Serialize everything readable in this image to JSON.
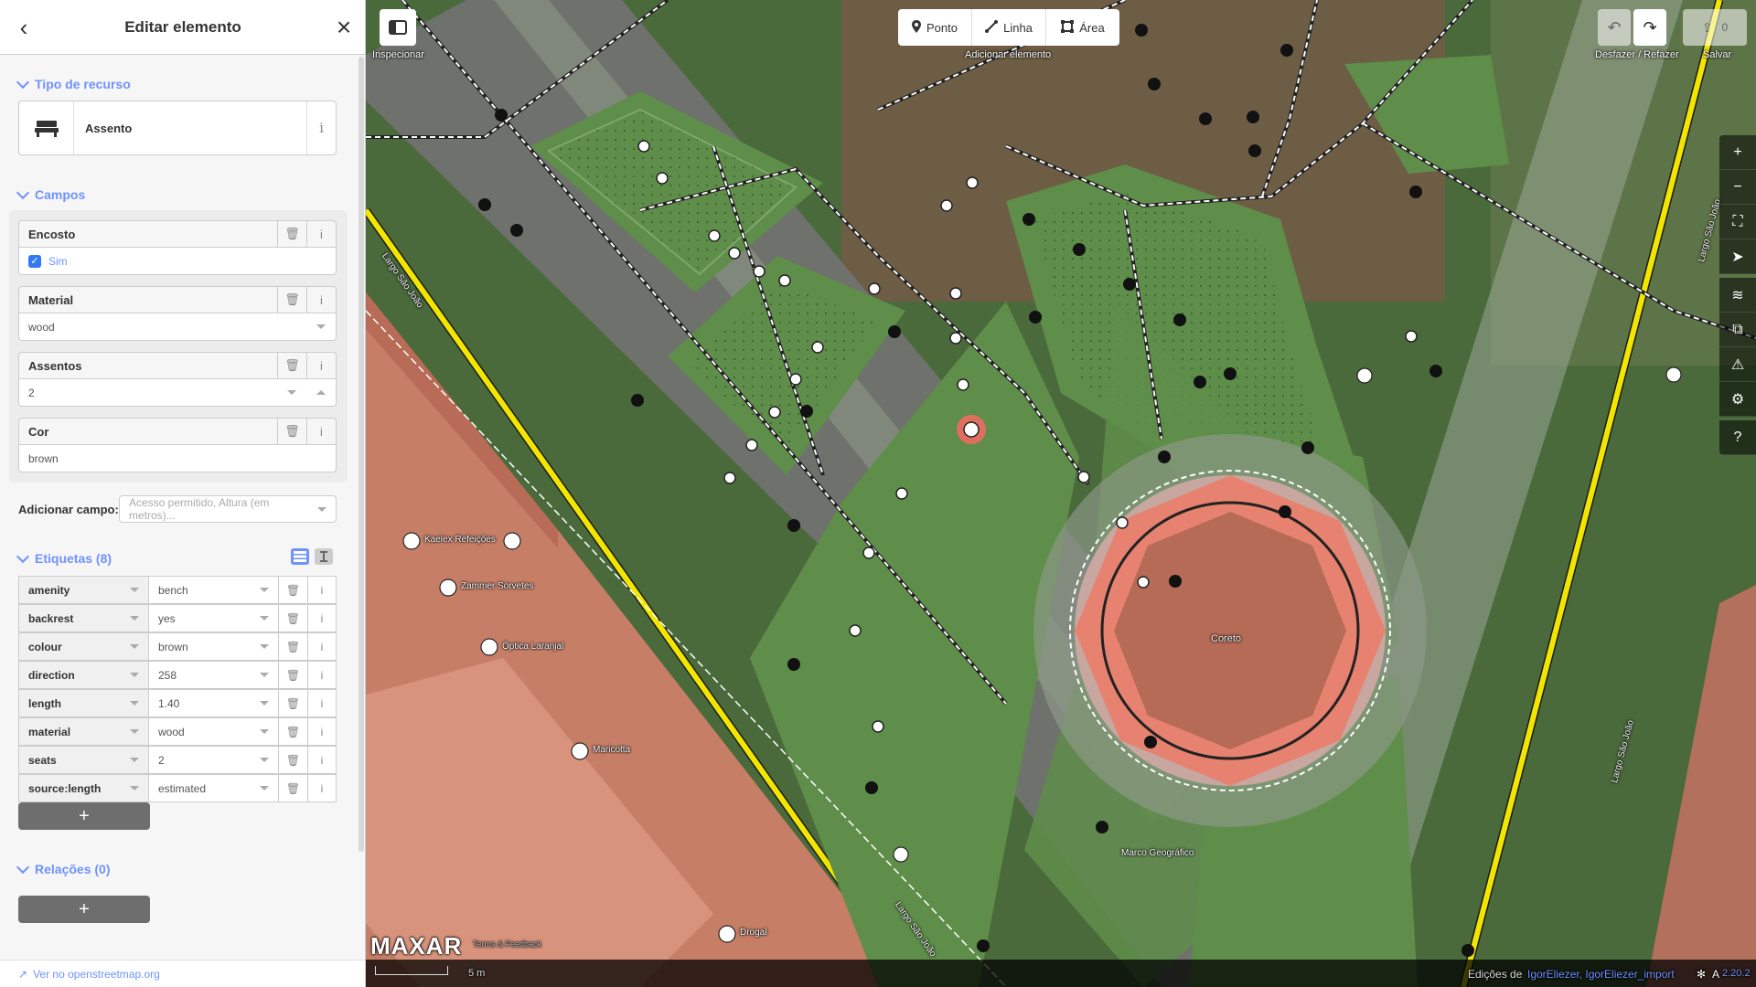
{
  "sidebar": {
    "title": "Editar elemento",
    "section_preset": "Tipo de recurso",
    "preset_name": "Assento",
    "preset_info": "i",
    "section_fields": "Campos",
    "fields": {
      "backrest_label": "Encosto",
      "backrest_value": "Sim",
      "material_label": "Material",
      "material_value": "wood",
      "seats_label": "Assentos",
      "seats_value": "2",
      "colour_label": "Cor",
      "colour_value": "brown"
    },
    "add_field_label": "Adicionar campo:",
    "add_field_placeholder": "Acesso permitido, Altura (em metros)...",
    "section_tags": "Etiquetas (8)",
    "tags": [
      {
        "key": "amenity",
        "value": "bench"
      },
      {
        "key": "backrest",
        "value": "yes"
      },
      {
        "key": "colour",
        "value": "brown"
      },
      {
        "key": "direction",
        "value": "258"
      },
      {
        "key": "length",
        "value": "1.40"
      },
      {
        "key": "material",
        "value": "wood"
      },
      {
        "key": "seats",
        "value": "2"
      },
      {
        "key": "source:length",
        "value": "estimated"
      }
    ],
    "add_button": "+",
    "section_relations": "Relações (0)",
    "footer_link": "Ver no openstreetmap.org",
    "info_glyph": "i"
  },
  "toolbar": {
    "inspect_label": "Inspecionar",
    "mode_point": "Ponto",
    "mode_line": "Linha",
    "mode_area": "Área",
    "add_label": "Adicionar elemento",
    "undo_redo_label": "Desfazer / Refazer",
    "save_label": "Salvar",
    "save_count": "0"
  },
  "map": {
    "street_labels": [
      "Largo São João",
      "Largo São João",
      "Largo São João",
      "Largo São João"
    ],
    "poi_labels": {
      "kaelex": "Kaelex Refeições",
      "zammer": "Zammer Sorvetes",
      "optica": "Óptica Laranjal",
      "maricotta": "Maricotta",
      "drogal": "Drogal",
      "coreto": "Coreto",
      "marco": "Marco Geográfico"
    },
    "imagery_brand": "MAXAR",
    "imagery_terms": "Terms & Feedback",
    "scale_label": "5 m",
    "edits_prefix": "Edições de",
    "edits_users": "IgorEliezer, IgorEliezer_import",
    "version": "2.20.2",
    "colors": {
      "selected": "#e06e5f",
      "accent": "#7092ff",
      "street_yellow": "#f2e600",
      "grass": "#5f8d4a"
    }
  }
}
